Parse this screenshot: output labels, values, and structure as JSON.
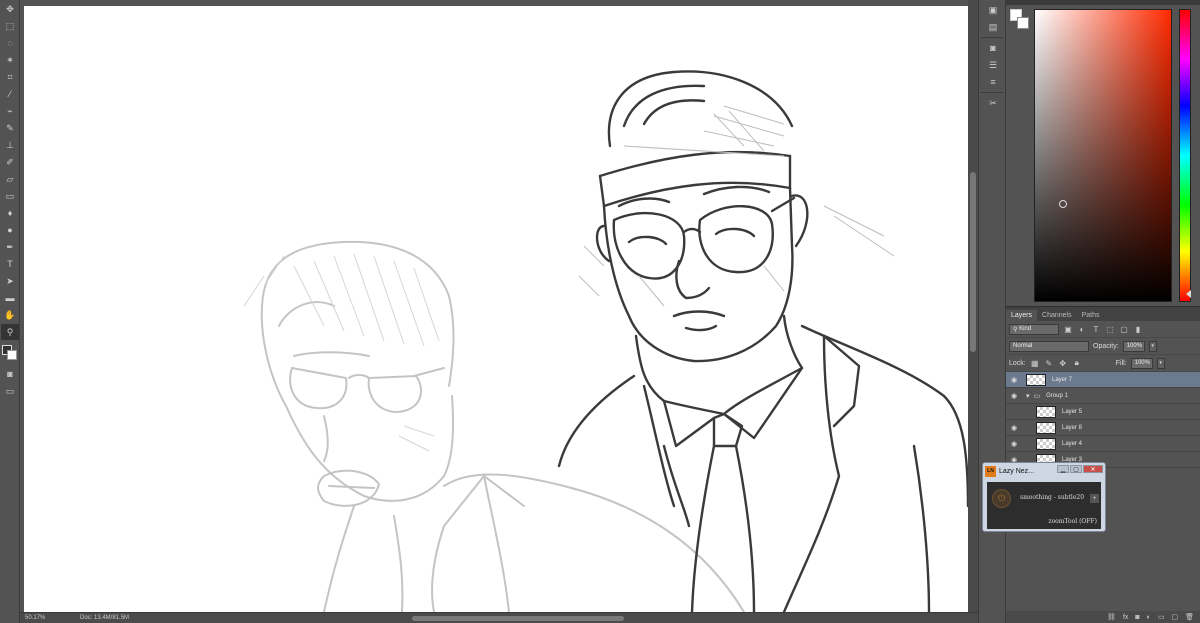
{
  "tools": [
    {
      "name": "move-tool-icon",
      "glyph": "✥"
    },
    {
      "name": "marquee-tool-icon",
      "glyph": "⬚"
    },
    {
      "name": "lasso-tool-icon",
      "glyph": "◌"
    },
    {
      "name": "magic-wand-tool-icon",
      "glyph": "✶"
    },
    {
      "name": "crop-tool-icon",
      "glyph": "⌗"
    },
    {
      "name": "eyedropper-tool-icon",
      "glyph": "⁄"
    },
    {
      "name": "healing-brush-tool-icon",
      "glyph": "⌁"
    },
    {
      "name": "brush-tool-icon",
      "glyph": "✎"
    },
    {
      "name": "stamp-tool-icon",
      "glyph": "⊥"
    },
    {
      "name": "history-brush-tool-icon",
      "glyph": "✐"
    },
    {
      "name": "eraser-tool-icon",
      "glyph": "▱"
    },
    {
      "name": "gradient-tool-icon",
      "glyph": "▭"
    },
    {
      "name": "blur-tool-icon",
      "glyph": "♦"
    },
    {
      "name": "dodge-tool-icon",
      "glyph": "●"
    },
    {
      "name": "pen-tool-icon",
      "glyph": "✒"
    },
    {
      "name": "type-tool-icon",
      "glyph": "T"
    },
    {
      "name": "path-selection-tool-icon",
      "glyph": "➤"
    },
    {
      "name": "shape-tool-icon",
      "glyph": "▬"
    },
    {
      "name": "hand-tool-icon",
      "glyph": "✋"
    },
    {
      "name": "zoom-tool-icon",
      "glyph": "⚲"
    }
  ],
  "status": {
    "zoom": "50.17%",
    "doc": "Doc: 13.4M/81.5M"
  },
  "layers_panel": {
    "tabs": [
      "Layers",
      "Channels",
      "Paths"
    ],
    "kind_filter": "Kind",
    "blend_mode": "Normal",
    "opacity_label": "Opacity:",
    "opacity_value": "100%",
    "lock_label": "Lock:",
    "fill_label": "Fill:",
    "fill_value": "100%",
    "layers": [
      {
        "name": "Layer 7",
        "visible": true,
        "selected": true,
        "type": "layer"
      },
      {
        "name": "Group 1",
        "visible": true,
        "selected": false,
        "type": "group"
      },
      {
        "name": "Layer 5",
        "visible": false,
        "selected": false,
        "type": "layer"
      },
      {
        "name": "Layer 8",
        "visible": true,
        "selected": false,
        "type": "layer"
      },
      {
        "name": "Layer 4",
        "visible": true,
        "selected": false,
        "type": "layer"
      },
      {
        "name": "Layer 3",
        "visible": true,
        "selected": false,
        "type": "layer"
      }
    ]
  },
  "lazy_nezumi": {
    "title": "Lazy Nez...",
    "logo": "LN",
    "preset": "smoothing - subtle20",
    "zoom_tool": "zoomTool (OFF)"
  }
}
